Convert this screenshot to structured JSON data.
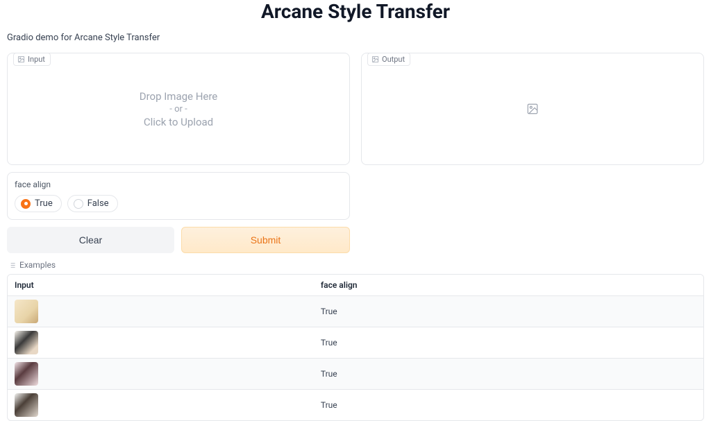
{
  "title": "Arcane Style Transfer",
  "description": "Gradio demo for Arcane Style Transfer",
  "input": {
    "label": "Input",
    "drop_text": "Drop Image Here",
    "or_text": "- or -",
    "click_text": "Click to Upload"
  },
  "output": {
    "label": "Output"
  },
  "face_align": {
    "label": "face align",
    "options": {
      "true": "True",
      "false": "False"
    },
    "selected": "true"
  },
  "buttons": {
    "clear": "Clear",
    "submit": "Submit"
  },
  "examples": {
    "label": "Examples",
    "headers": {
      "input": "Input",
      "face_align": "face align"
    },
    "rows": [
      {
        "face_align": "True"
      },
      {
        "face_align": "True"
      },
      {
        "face_align": "True"
      },
      {
        "face_align": "True"
      }
    ]
  }
}
